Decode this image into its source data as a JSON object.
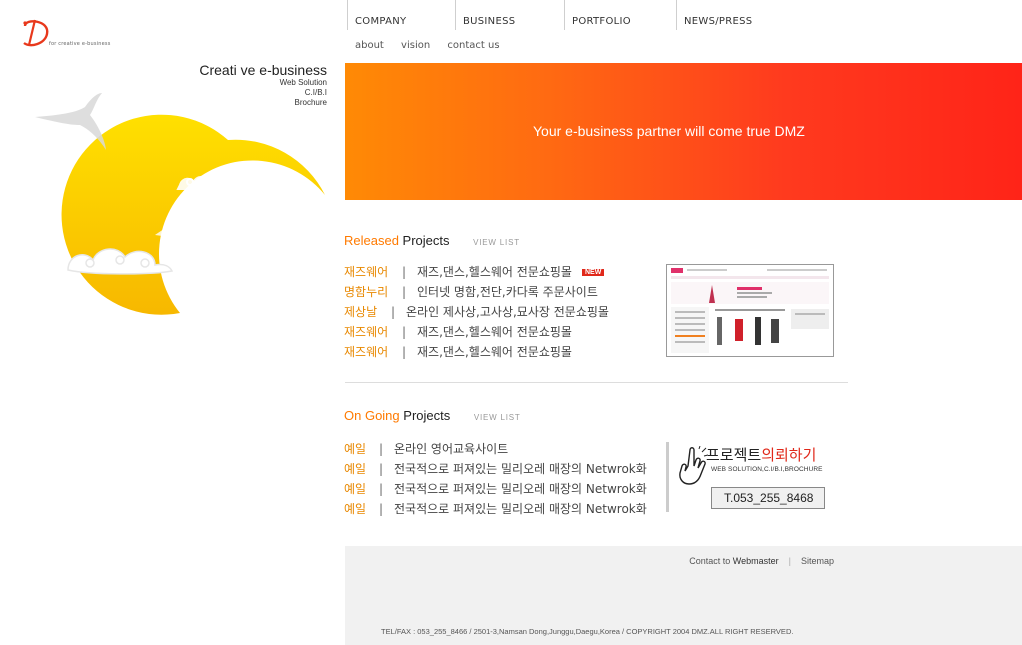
{
  "logo": {
    "mark_alt": "D",
    "tagline": "for creative e-business"
  },
  "nav": {
    "items": [
      {
        "label": "COMPANY"
      },
      {
        "label": "BUSINESS"
      },
      {
        "label": "PORTFOLIO"
      },
      {
        "label": "NEWS/PRESS"
      }
    ],
    "subnav": [
      "about",
      "vision",
      "contact us"
    ]
  },
  "slogan": {
    "title": "Creati ve e-business",
    "lines": [
      "Web Solution",
      "C.I/B.I",
      "Brochure"
    ]
  },
  "banner": {
    "text": "Your e-business partner will come true DMZ"
  },
  "released": {
    "heading_highlight": "Released",
    "heading_rest": " Projects",
    "view_list": "VIEW LIST",
    "new_badge": "NEW",
    "items": [
      {
        "category": "재즈웨어",
        "title": "재즈,댄스,헬스웨어 전문쇼핑몰"
      },
      {
        "category": "명함누리",
        "title": "인터넷 명함,전단,카다록 주문사이트"
      },
      {
        "category": "제상날",
        "title": "온라인 제사상,고사상,묘사장 전문쇼핑몰"
      },
      {
        "category": "재즈웨어",
        "title": "재즈,댄스,헬스웨어 전문쇼핑몰"
      },
      {
        "category": "재즈웨어",
        "title": "재즈,댄스,헬스웨어 전문쇼핑몰"
      }
    ]
  },
  "ongoing": {
    "heading_highlight": "On Going",
    "heading_rest": " Projects",
    "view_list": "VIEW LIST",
    "items": [
      {
        "category": "예일",
        "title": "온라인 영어교육사이트"
      },
      {
        "category": "예일",
        "title": "전국적으로 퍼져있는 밀리오레 매장의 Netwrok화"
      },
      {
        "category": "예일",
        "title": "전국적으로 퍼져있는 밀리오레 매장의 Netwrok화"
      },
      {
        "category": "예일",
        "title": "전국적으로 퍼져있는 밀리오레 매장의 Netwrok화"
      }
    ]
  },
  "request": {
    "title_a": "프로젝트",
    "title_b": "의뢰하기",
    "subtitle": "WEB SOLUTION,C.I/B.I,BROCHURE",
    "phone": "T.053_255_8468"
  },
  "footer": {
    "contact_prefix": "Contact to ",
    "contact_link": "Webmaster",
    "sitemap": "Sitemap",
    "copyright": "TEL/FAX : 053_255_8466  /  2501-3,Namsan Dong,Junggu,Daegu,Korea  /  COPYRIGHT 2004 DMZ.ALL RIGHT RESERVED."
  },
  "colors": {
    "accent": "#ff7a00",
    "banner_start": "#ff8a05",
    "banner_end": "#ff2418",
    "moon": "#ffd000"
  }
}
